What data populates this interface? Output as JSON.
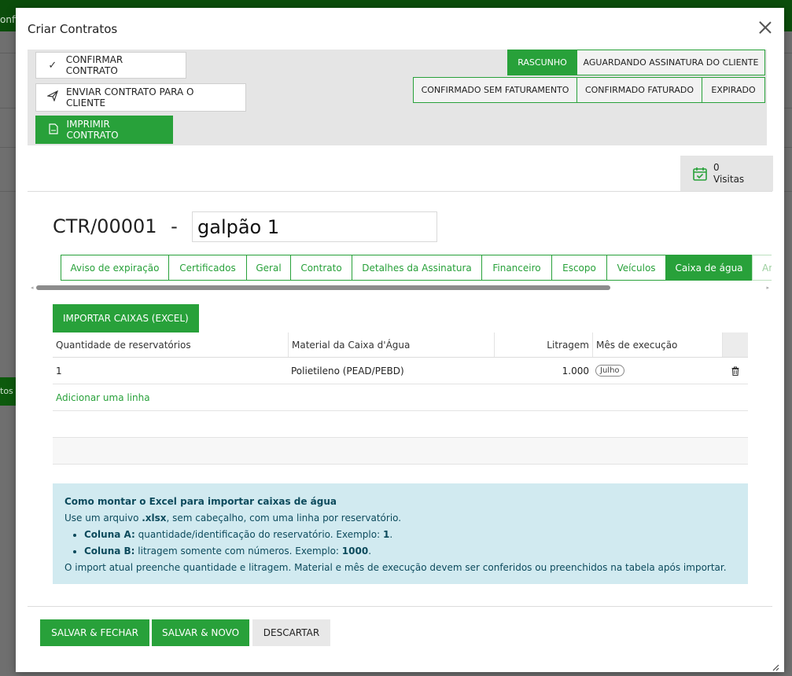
{
  "backdrop": {
    "topbar_fragment": "onfi",
    "side_fragment": "tos"
  },
  "modal": {
    "title": "Criar Contratos"
  },
  "actions": {
    "confirm": "CONFIRMAR CONTRATO",
    "send": "ENVIAR CONTRATO PARA O CLIENTE",
    "print": "IMPRIMIR CONTRATO"
  },
  "statuses": [
    {
      "label": "RASCUNHO",
      "active": true
    },
    {
      "label": "AGUARDANDO ASSINATURA DO CLIENTE",
      "active": false
    },
    {
      "label": "CONFIRMADO SEM FATURAMENTO",
      "active": false
    },
    {
      "label": "CONFIRMADO FATURADO",
      "active": false
    },
    {
      "label": "EXPIRADO",
      "active": false
    }
  ],
  "visits": {
    "count": "0",
    "label": "Visitas"
  },
  "record": {
    "code": "CTR/00001",
    "separator": "-",
    "name": "galpão 1"
  },
  "tabs": [
    {
      "label": "Aviso de expiração"
    },
    {
      "label": "Certificados"
    },
    {
      "label": "Geral"
    },
    {
      "label": "Contrato"
    },
    {
      "label": "Detalhes da Assinatura"
    },
    {
      "label": "Financeiro"
    },
    {
      "label": "Escopo"
    },
    {
      "label": "Veículos"
    },
    {
      "label": "Caixa de água",
      "active": true
    },
    {
      "label": "An"
    }
  ],
  "import_button": "IMPORTAR CAIXAS (EXCEL)",
  "table": {
    "columns": [
      "Quantidade de reservatórios",
      "Material da Caixa d'Água",
      "Litragem",
      "Mês de execução"
    ],
    "rows": [
      {
        "quantity": "1",
        "material": "Polietileno (PEAD/PEBD)",
        "liters": "1.000",
        "month": "Julho"
      }
    ],
    "add_line": "Adicionar uma linha"
  },
  "info": {
    "title": "Como montar o Excel para importar caixas de água",
    "intro_pre": "Use um arquivo ",
    "intro_ext": ".xlsx",
    "intro_post": ", sem cabeçalho, com uma linha por reservatório.",
    "col_a_label": "Coluna A:",
    "col_a_text": " quantidade/identificação do reservatório. Exemplo: ",
    "col_a_example": "1",
    "col_b_label": "Coluna B:",
    "col_b_text": " litragem somente com números. Exemplo: ",
    "col_b_example": "1000",
    "dot": ".",
    "note": "O import atual preenche quantidade e litragem. Material e mês de execução devem ser conferidos ou preenchidos na tabela após importar."
  },
  "footer": {
    "save_close": "SALVAR & FECHAR",
    "save_new": "SALVAR & NOVO",
    "discard": "DESCARTAR"
  },
  "colors": {
    "accent": "#28a13a",
    "info_bg": "#d1eaf0",
    "info_text": "#0c4a5c",
    "topbar": "#0b4d0b"
  },
  "icons": [
    "check-icon",
    "send-icon",
    "pdf-file-icon",
    "calendar-check-icon",
    "trash-icon",
    "close-icon",
    "resize-grip-icon"
  ]
}
